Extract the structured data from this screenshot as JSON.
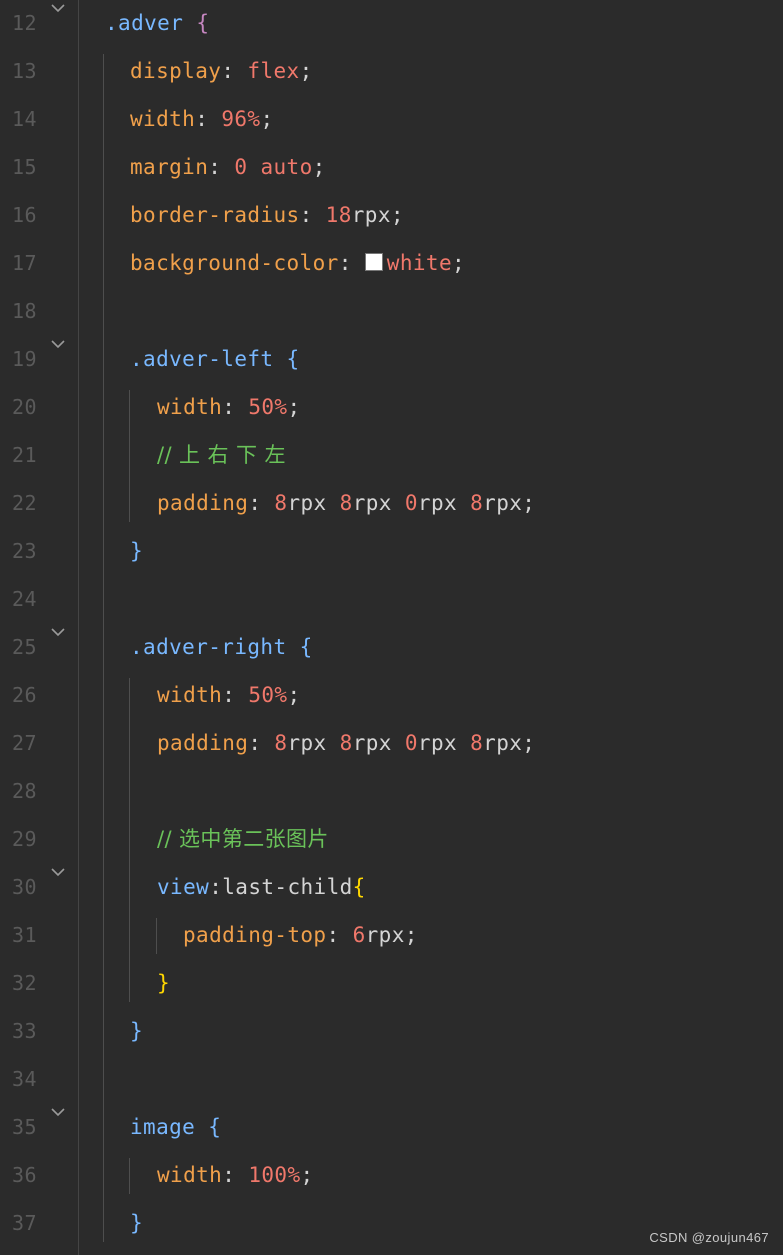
{
  "colors": {
    "background": "#2b2b2b",
    "line_number": "#5a5a5a",
    "selector": "#79b8ff",
    "brace_outer": "#c586c0",
    "brace_inner": "#79b8ff",
    "brace_nested": "#ffd700",
    "property": "#f0a04b",
    "value": "#f0786b",
    "punctuation": "#d4d4d4",
    "comment": "#6ac259",
    "fold_icon": "#9a9a9a"
  },
  "editor": {
    "lines": [
      {
        "number": "12",
        "fold": true,
        "tokens": [
          {
            "text": ".adver ",
            "type": "selector"
          },
          {
            "text": "{",
            "type": "brace_outer"
          }
        ]
      },
      {
        "number": "13",
        "fold": false,
        "tokens": [
          {
            "text": "display",
            "type": "property"
          },
          {
            "text": ": ",
            "type": "punctuation"
          },
          {
            "text": "flex",
            "type": "value"
          },
          {
            "text": ";",
            "type": "punctuation"
          }
        ]
      },
      {
        "number": "14",
        "fold": false,
        "tokens": [
          {
            "text": "width",
            "type": "property"
          },
          {
            "text": ": ",
            "type": "punctuation"
          },
          {
            "text": "96%",
            "type": "value"
          },
          {
            "text": ";",
            "type": "punctuation"
          }
        ]
      },
      {
        "number": "15",
        "fold": false,
        "tokens": [
          {
            "text": "margin",
            "type": "property"
          },
          {
            "text": ": ",
            "type": "punctuation"
          },
          {
            "text": "0 auto",
            "type": "value"
          },
          {
            "text": ";",
            "type": "punctuation"
          }
        ]
      },
      {
        "number": "16",
        "fold": false,
        "tokens": [
          {
            "text": "border-radius",
            "type": "property"
          },
          {
            "text": ": ",
            "type": "punctuation"
          },
          {
            "text": "18",
            "type": "value"
          },
          {
            "text": "rpx",
            "type": "punctuation"
          },
          {
            "text": ";",
            "type": "punctuation"
          }
        ]
      },
      {
        "number": "17",
        "fold": false,
        "tokens": [
          {
            "text": "background-color",
            "type": "property"
          },
          {
            "text": ": ",
            "type": "punctuation"
          },
          {
            "text": "",
            "type": "swatch"
          },
          {
            "text": "white",
            "type": "value"
          },
          {
            "text": ";",
            "type": "punctuation"
          }
        ]
      },
      {
        "number": "18",
        "fold": false,
        "tokens": []
      },
      {
        "number": "19",
        "fold": true,
        "tokens": [
          {
            "text": ".adver-left ",
            "type": "selector"
          },
          {
            "text": "{",
            "type": "brace_inner"
          }
        ]
      },
      {
        "number": "20",
        "fold": false,
        "tokens": [
          {
            "text": "width",
            "type": "property"
          },
          {
            "text": ": ",
            "type": "punctuation"
          },
          {
            "text": "50%",
            "type": "value"
          },
          {
            "text": ";",
            "type": "punctuation"
          }
        ]
      },
      {
        "number": "21",
        "fold": false,
        "tokens": [
          {
            "text": "// 上 右 下 左",
            "type": "comment"
          }
        ]
      },
      {
        "number": "22",
        "fold": false,
        "tokens": [
          {
            "text": "padding",
            "type": "property"
          },
          {
            "text": ": ",
            "type": "punctuation"
          },
          {
            "text": "8",
            "type": "value"
          },
          {
            "text": "rpx ",
            "type": "punctuation"
          },
          {
            "text": "8",
            "type": "value"
          },
          {
            "text": "rpx ",
            "type": "punctuation"
          },
          {
            "text": "0",
            "type": "value"
          },
          {
            "text": "rpx ",
            "type": "punctuation"
          },
          {
            "text": "8",
            "type": "value"
          },
          {
            "text": "rpx",
            "type": "punctuation"
          },
          {
            "text": ";",
            "type": "punctuation"
          }
        ]
      },
      {
        "number": "23",
        "fold": false,
        "tokens": [
          {
            "text": "}",
            "type": "brace_inner"
          }
        ]
      },
      {
        "number": "24",
        "fold": false,
        "tokens": []
      },
      {
        "number": "25",
        "fold": true,
        "tokens": [
          {
            "text": ".adver-right ",
            "type": "selector"
          },
          {
            "text": "{",
            "type": "brace_inner"
          }
        ]
      },
      {
        "number": "26",
        "fold": false,
        "tokens": [
          {
            "text": "width",
            "type": "property"
          },
          {
            "text": ": ",
            "type": "punctuation"
          },
          {
            "text": "50%",
            "type": "value"
          },
          {
            "text": ";",
            "type": "punctuation"
          }
        ]
      },
      {
        "number": "27",
        "fold": false,
        "tokens": [
          {
            "text": "padding",
            "type": "property"
          },
          {
            "text": ": ",
            "type": "punctuation"
          },
          {
            "text": "8",
            "type": "value"
          },
          {
            "text": "rpx ",
            "type": "punctuation"
          },
          {
            "text": "8",
            "type": "value"
          },
          {
            "text": "rpx ",
            "type": "punctuation"
          },
          {
            "text": "0",
            "type": "value"
          },
          {
            "text": "rpx ",
            "type": "punctuation"
          },
          {
            "text": "8",
            "type": "value"
          },
          {
            "text": "rpx",
            "type": "punctuation"
          },
          {
            "text": ";",
            "type": "punctuation"
          }
        ]
      },
      {
        "number": "28",
        "fold": false,
        "tokens": []
      },
      {
        "number": "29",
        "fold": false,
        "tokens": [
          {
            "text": "// 选中第二张图片",
            "type": "comment"
          }
        ]
      },
      {
        "number": "30",
        "fold": true,
        "tokens": [
          {
            "text": "view",
            "type": "selector"
          },
          {
            "text": ":last-child",
            "type": "punctuation"
          },
          {
            "text": "{",
            "type": "brace_nested"
          }
        ]
      },
      {
        "number": "31",
        "fold": false,
        "tokens": [
          {
            "text": "padding-top",
            "type": "property"
          },
          {
            "text": ": ",
            "type": "punctuation"
          },
          {
            "text": "6",
            "type": "value"
          },
          {
            "text": "rpx",
            "type": "punctuation"
          },
          {
            "text": ";",
            "type": "punctuation"
          }
        ]
      },
      {
        "number": "32",
        "fold": false,
        "tokens": [
          {
            "text": "}",
            "type": "brace_nested"
          }
        ]
      },
      {
        "number": "33",
        "fold": false,
        "tokens": [
          {
            "text": "}",
            "type": "brace_inner"
          }
        ]
      },
      {
        "number": "34",
        "fold": false,
        "tokens": []
      },
      {
        "number": "35",
        "fold": true,
        "tokens": [
          {
            "text": "image ",
            "type": "selector"
          },
          {
            "text": "{",
            "type": "brace_inner"
          }
        ]
      },
      {
        "number": "36",
        "fold": false,
        "tokens": [
          {
            "text": "width",
            "type": "property"
          },
          {
            "text": ": ",
            "type": "punctuation"
          },
          {
            "text": "100%",
            "type": "value"
          },
          {
            "text": ";",
            "type": "punctuation"
          }
        ]
      },
      {
        "number": "37",
        "fold": false,
        "tokens": [
          {
            "text": "}",
            "type": "brace_inner"
          }
        ]
      }
    ]
  },
  "watermark": {
    "text": "CSDN @zoujun467"
  }
}
